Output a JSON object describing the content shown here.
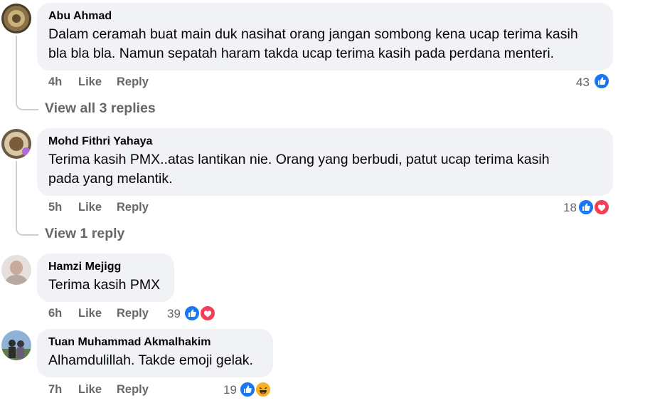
{
  "comments": [
    {
      "author": "Abu Ahmad",
      "lines": [
        "Dalam ceramah buat main duk nasihat orang jangan sombong kena ucap terima kasih",
        "bla bla bla. Namun sepatah haram takda ucap terima kasih pada perdana menteri."
      ],
      "time": "4h",
      "like_label": "Like",
      "reply_label": "Reply",
      "reaction_count": "43",
      "reactions": [
        "like"
      ],
      "view_replies": "View all 3 replies"
    },
    {
      "author": "Mohd Fithri Yahaya",
      "lines": [
        "Terima kasih PMX..atas lantikan nie. Orang yang berbudi, patut ucap terima kasih",
        "pada yang melantik."
      ],
      "time": "5h",
      "like_label": "Like",
      "reply_label": "Reply",
      "reaction_count": "18",
      "reactions": [
        "like",
        "love"
      ],
      "view_replies": "View 1 reply"
    },
    {
      "author": "Hamzi Mejigg",
      "lines": [
        "Terima kasih PMX"
      ],
      "time": "6h",
      "like_label": "Like",
      "reply_label": "Reply",
      "reaction_count": "39",
      "reactions": [
        "like",
        "love"
      ]
    },
    {
      "author": "Tuan Muhammad Akmalhakim",
      "lines": [
        "Alhamdulillah. Takde emoji gelak."
      ],
      "time": "7h",
      "like_label": "Like",
      "reply_label": "Reply",
      "reaction_count": "19",
      "reactions": [
        "like",
        "haha"
      ]
    }
  ],
  "colors": {
    "like": "#1877f2",
    "love": "#f33e58",
    "haha": "#f7b125",
    "bubble": "#f0f2f5",
    "meta": "#65676b"
  }
}
